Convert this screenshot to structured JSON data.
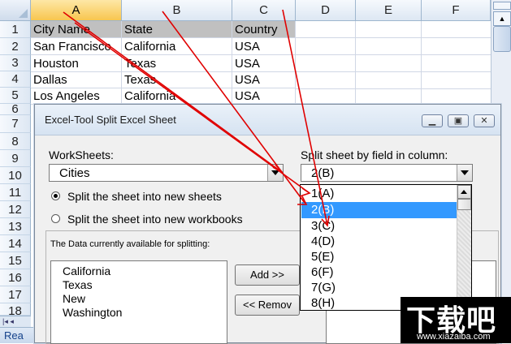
{
  "spreadsheet": {
    "columns": [
      "A",
      "B",
      "C",
      "D",
      "E",
      "F"
    ],
    "rows": [
      "1",
      "2",
      "3",
      "4",
      "5",
      "6",
      "7",
      "8",
      "9",
      "10",
      "11",
      "12",
      "13",
      "14",
      "15",
      "16",
      "17",
      "18"
    ],
    "header_row": [
      "City Name",
      "State",
      "Country"
    ],
    "data_rows": [
      [
        "San Francisco",
        "California",
        "USA"
      ],
      [
        "Houston",
        "Texas",
        "USA"
      ],
      [
        "Dallas",
        "Texas",
        "USA"
      ],
      [
        "Los Angeles",
        "California",
        "USA"
      ]
    ],
    "status_text": "Rea"
  },
  "dialog": {
    "title": "Excel-Tool Split Excel Sheet",
    "worksheets_label": "WorkSheets:",
    "worksheet_value": "Cities",
    "split_field_label": "Split sheet by field in column:",
    "split_field_value": "2(B)",
    "radio_new_sheets": "Split the sheet into new sheets",
    "radio_new_workbooks": "Split the sheet into new workbooks",
    "data_available_label": "The Data currently available for splitting:",
    "available_items": [
      "California",
      "Texas",
      "New",
      "Washington"
    ],
    "add_button": "Add >>",
    "remove_button": "<< Remov",
    "dropdown_options": [
      "1(A)",
      "2(B)",
      "3(C)",
      "4(D)",
      "5(E)",
      "6(F)",
      "7(G)",
      "8(H)"
    ],
    "dropdown_selected_index": 1
  },
  "watermark": {
    "text": "下载吧",
    "url": "www.xiazaiba.com"
  },
  "colors": {
    "selected_header": "#f8c64f",
    "selection_blue": "#3399ff",
    "annotation_red": "#e00000"
  }
}
